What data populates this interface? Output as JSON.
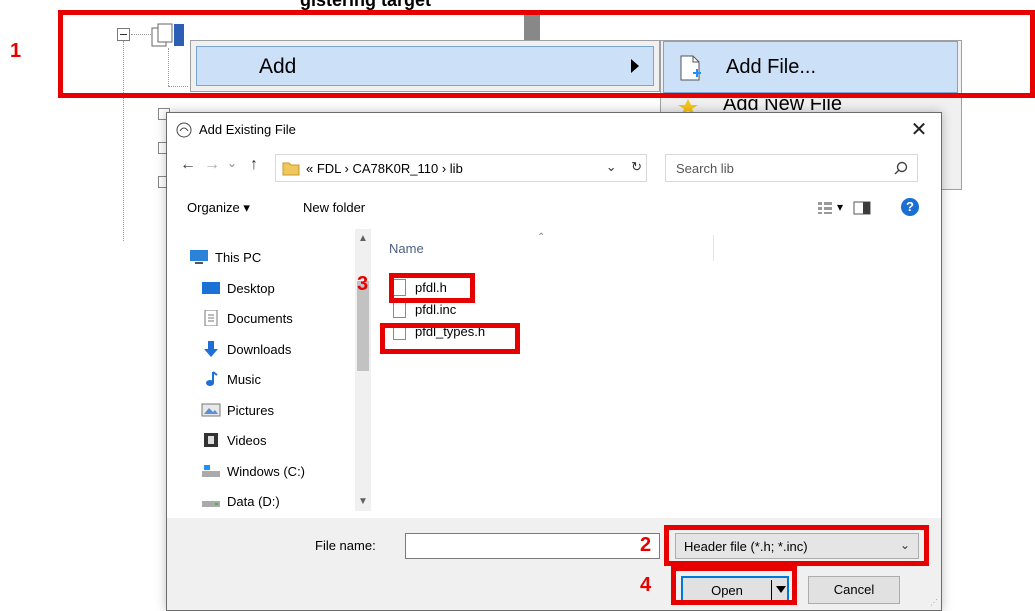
{
  "steps": {
    "s1": "1",
    "s2": "2",
    "s3": "3",
    "s4": "4"
  },
  "top_title_fragment": "gistering target",
  "context_menu": {
    "add_label": "Add"
  },
  "sub_menu": {
    "add_file_label": "Add File...",
    "add_new_file_label": "Add New File"
  },
  "dialog": {
    "title": "Add Existing File",
    "close": "✕",
    "nav": {
      "back": "←",
      "forward": "→",
      "recent": "⌄",
      "up": "↑"
    },
    "address": {
      "path": "«  FDL  ›  CA78K0R_110  ›  lib",
      "dropdown": "⌄",
      "refresh": "↻"
    },
    "search": {
      "placeholder": "Search lib"
    },
    "toolbar": {
      "organize": "Organize ▾",
      "new_folder": "New folder",
      "view": "▾",
      "help": "?"
    },
    "nav_pane": [
      {
        "label": "This PC",
        "icon": "this-pc-icon"
      },
      {
        "label": "Desktop",
        "icon": "desktop-icon"
      },
      {
        "label": "Documents",
        "icon": "documents-icon"
      },
      {
        "label": "Downloads",
        "icon": "downloads-icon"
      },
      {
        "label": "Music",
        "icon": "music-icon"
      },
      {
        "label": "Pictures",
        "icon": "pictures-icon"
      },
      {
        "label": "Videos",
        "icon": "videos-icon"
      },
      {
        "label": "Windows (C:)",
        "icon": "drive-c-icon"
      },
      {
        "label": "Data (D:)",
        "icon": "drive-d-icon"
      }
    ],
    "file_list": {
      "column_name": "Name",
      "files": [
        "pfdl.h",
        "pfdl.inc",
        "pfdl_types.h"
      ]
    },
    "bottom": {
      "file_name_label": "File name:",
      "file_name_value": "",
      "file_type": "Header file (*.h; *.inc)",
      "open_label": "Open",
      "cancel_label": "Cancel"
    }
  },
  "colors": {
    "highlight": "#e60000",
    "menu_selection": "#cce0f7",
    "accent": "#0078d7"
  }
}
